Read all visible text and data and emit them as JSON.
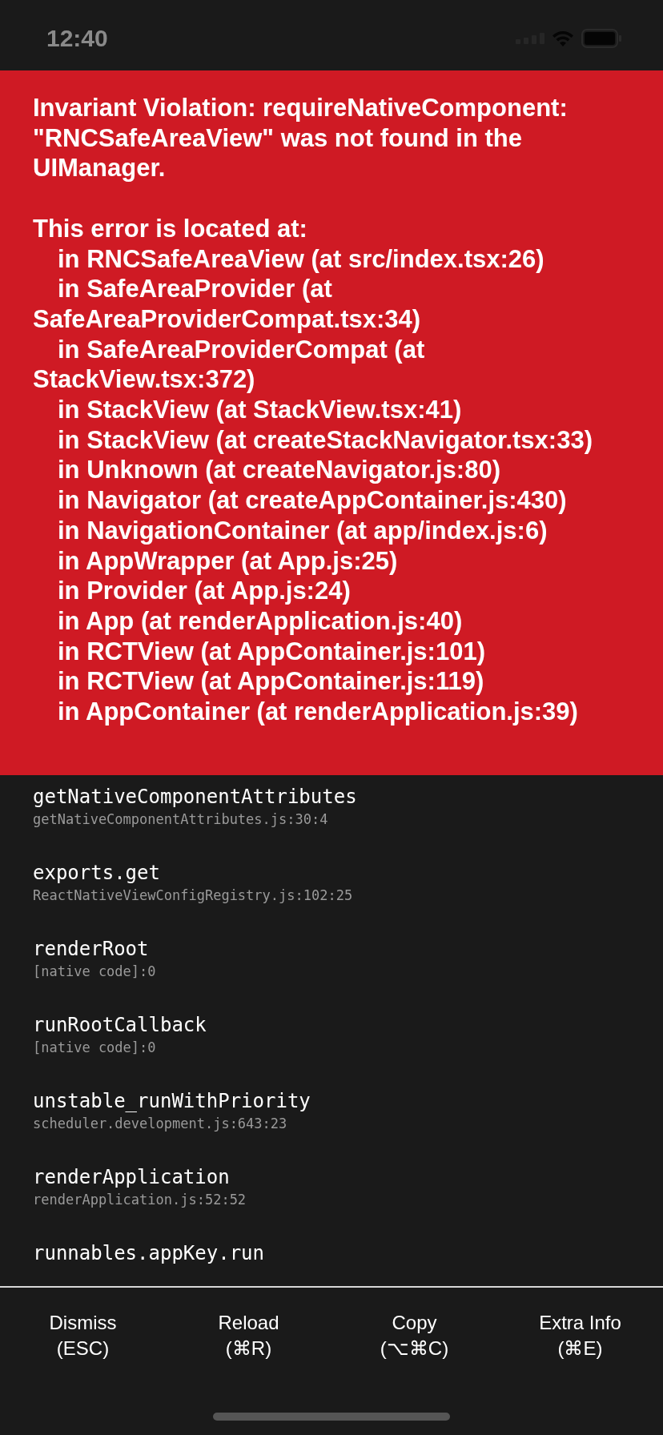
{
  "status_bar": {
    "time": "12:40"
  },
  "error": {
    "message": "Invariant Violation: requireNativeComponent: \"RNCSafeAreaView\" was not found in the UIManager.",
    "location_header": "This error is located at:",
    "frames": [
      "in RNCSafeAreaView (at src/index.tsx:26)",
      "in SafeAreaProvider (at SafeAreaProviderCompat.tsx:34)",
      "in SafeAreaProviderCompat (at StackView.tsx:372)",
      "in StackView (at StackView.tsx:41)",
      "in StackView (at createStackNavigator.tsx:33)",
      "in Unknown (at createNavigator.js:80)",
      "in Navigator (at createAppContainer.js:430)",
      "in NavigationContainer (at app/index.js:6)",
      "in AppWrapper (at App.js:25)",
      "in Provider (at App.js:24)",
      "in App (at renderApplication.js:40)",
      "in RCTView (at AppContainer.js:101)",
      "in RCTView (at AppContainer.js:119)",
      "in AppContainer (at renderApplication.js:39)"
    ]
  },
  "stack": [
    {
      "method": "getNativeComponentAttributes",
      "file": "getNativeComponentAttributes.js:30:4"
    },
    {
      "method": "exports.get",
      "file": "ReactNativeViewConfigRegistry.js:102:25"
    },
    {
      "method": "renderRoot",
      "file": "[native code]:0"
    },
    {
      "method": "runRootCallback",
      "file": "[native code]:0"
    },
    {
      "method": "unstable_runWithPriority",
      "file": "scheduler.development.js:643:23"
    },
    {
      "method": "renderApplication",
      "file": "renderApplication.js:52:52"
    },
    {
      "method": "runnables.appKey.run"
    }
  ],
  "buttons": [
    {
      "label": "Dismiss",
      "shortcut": "(ESC)"
    },
    {
      "label": "Reload",
      "shortcut": "(⌘R)"
    },
    {
      "label": "Copy",
      "shortcut": "(⌥⌘C)"
    },
    {
      "label": "Extra Info",
      "shortcut": "(⌘E)"
    }
  ]
}
